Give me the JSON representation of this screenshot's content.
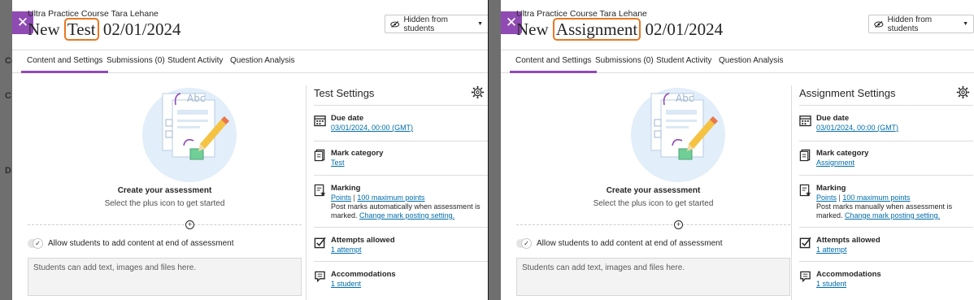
{
  "left": {
    "course": "Ultra Practice Course Tara Lehane",
    "title_prefix": "New",
    "title_highlight": "Test",
    "title_suffix": "02/01/2024",
    "visibility": "Hidden from students",
    "tabs": [
      "Content and Settings",
      "Submissions (0)",
      "Student Activity",
      "Question Analysis"
    ],
    "create_title": "Create your assessment",
    "create_sub": "Select the plus icon to get started",
    "toggle_label": "Allow students to add content at end of assessment",
    "textarea_placeholder": "Students can add text, images and files here.",
    "settings_title": "Test Settings",
    "due_date_label": "Due date",
    "due_date_value": "03/01/2024, 00:00 (GMT)",
    "mark_category_label": "Mark category",
    "mark_category_value": "Test",
    "marking_label": "Marking",
    "marking_points": "Points",
    "marking_max": "100 maximum points",
    "marking_note1": "Post marks automatically when assessment is",
    "marking_note2": "marked.",
    "marking_link": "Change mark posting setting.",
    "attempts_label": "Attempts allowed",
    "attempts_value": "1 attempt",
    "accommodations_label": "Accommodations",
    "accommodations_value": "1 student"
  },
  "right": {
    "course": "Ultra Practice Course Tara Lehane",
    "title_prefix": "New",
    "title_highlight": "Assignment",
    "title_suffix": "02/01/2024",
    "visibility": "Hidden from students",
    "tabs": [
      "Content and Settings",
      "Submissions (0)",
      "Student Activity",
      "Question Analysis"
    ],
    "create_title": "Create your assessment",
    "create_sub": "Select the plus icon to get started",
    "toggle_label": "Allow students to add content at end of assessment",
    "textarea_placeholder": "Students can add text, images and files here.",
    "settings_title": "Assignment Settings",
    "due_date_label": "Due date",
    "due_date_value": "03/01/2024, 00:00 (GMT)",
    "mark_category_label": "Mark category",
    "mark_category_value": "Assignment",
    "marking_label": "Marking",
    "marking_points": "Points",
    "marking_max": "100 maximum points",
    "marking_note1": "Post marks manually when assessment is",
    "marking_note2": "marked.",
    "marking_link": "Change mark posting setting.",
    "attempts_label": "Attempts allowed",
    "attempts_value": "1 attempt",
    "accommodations_label": "Accommodations",
    "accommodations_value": "1 student"
  },
  "background_fragments": [
    "Co",
    "C",
    "D"
  ],
  "illustration_text": "Abc",
  "colors": {
    "accent": "#8f4bb3",
    "highlight": "#e87722",
    "link": "#006ca8"
  },
  "icons": [
    "close-icon",
    "eye-slash-icon",
    "chevron-down-icon",
    "gear-icon",
    "calendar-icon",
    "document-icon",
    "marking-icon",
    "checkbox-icon",
    "accommodations-icon",
    "plus-circle-icon",
    "check-icon"
  ]
}
